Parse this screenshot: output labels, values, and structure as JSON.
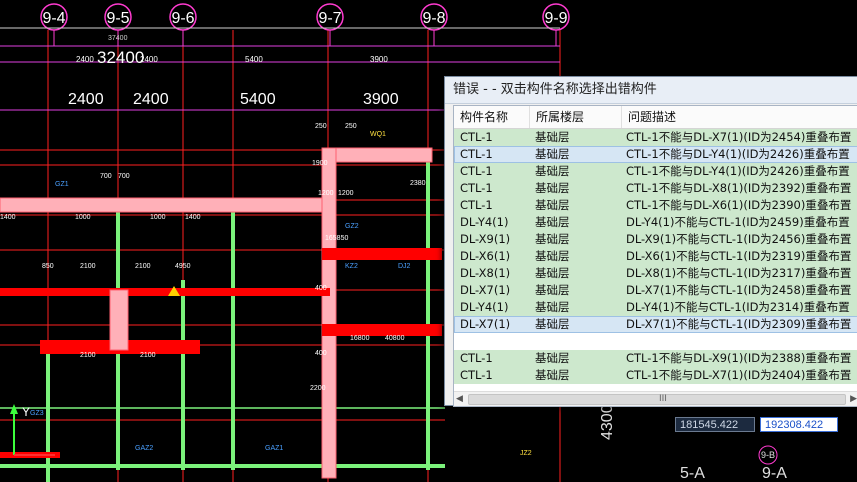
{
  "cad": {
    "axis_labels": [
      "9-4",
      "9-5",
      "9-6",
      "9-7",
      "9-8",
      "9-9"
    ],
    "dim_total_small": "37400",
    "dim_total": "32400",
    "dim_small": [
      "2400",
      "2400",
      "5400",
      "3900"
    ],
    "dim_large": [
      "2400",
      "2400",
      "5400",
      "3900"
    ],
    "misc_labels": [
      "700",
      "700",
      "1000",
      "1000",
      "1400",
      "1400",
      "2100",
      "2100",
      "2100",
      "2100",
      "1200",
      "1200",
      "250",
      "250",
      "WQ1",
      "GZ1",
      "GZ2",
      "GZ3",
      "GAZ1",
      "GAZ2",
      "JZ2",
      "KZ2",
      "DJ2",
      "16800",
      "40800",
      "165850",
      "850",
      "4950",
      "400",
      "400",
      "2200",
      "1900",
      "2380"
    ],
    "bottom_labels": [
      "5-A",
      "9-A",
      "9-B"
    ],
    "side_label": "4300",
    "ucs_y": "Y"
  },
  "dialog": {
    "title": "错误 - - 双击构件名称选择出错构件",
    "columns": [
      "构件名称",
      "所属楼层",
      "问题描述"
    ],
    "rows": [
      {
        "name": "CTL-1",
        "floor": "基础层",
        "desc": "CTL-1不能与DL-X7(1)(ID为2454)重叠布置"
      },
      {
        "name": "CTL-1",
        "floor": "基础层",
        "desc": "CTL-1不能与DL-Y4(1)(ID为2426)重叠布置"
      },
      {
        "name": "CTL-1",
        "floor": "基础层",
        "desc": "CTL-1不能与DL-Y4(1)(ID为2426)重叠布置"
      },
      {
        "name": "CTL-1",
        "floor": "基础层",
        "desc": "CTL-1不能与DL-X8(1)(ID为2392)重叠布置"
      },
      {
        "name": "CTL-1",
        "floor": "基础层",
        "desc": "CTL-1不能与DL-X6(1)(ID为2390)重叠布置"
      },
      {
        "name": "DL-Y4(1)",
        "floor": "基础层",
        "desc": "DL-Y4(1)不能与CTL-1(ID为2459)重叠布置"
      },
      {
        "name": "DL-X9(1)",
        "floor": "基础层",
        "desc": "DL-X9(1)不能与CTL-1(ID为2456)重叠布置"
      },
      {
        "name": "DL-X6(1)",
        "floor": "基础层",
        "desc": "DL-X6(1)不能与CTL-1(ID为2319)重叠布置"
      },
      {
        "name": "DL-X8(1)",
        "floor": "基础层",
        "desc": "DL-X8(1)不能与CTL-1(ID为2317)重叠布置"
      },
      {
        "name": "DL-X7(1)",
        "floor": "基础层",
        "desc": "DL-X7(1)不能与CTL-1(ID为2458)重叠布置"
      },
      {
        "name": "DL-Y4(1)",
        "floor": "基础层",
        "desc": "DL-Y4(1)不能与CTL-1(ID为2314)重叠布置"
      },
      {
        "name": "DL-X7(1)",
        "floor": "基础层",
        "desc": "DL-X7(1)不能与CTL-1(ID为2309)重叠布置"
      }
    ],
    "rows_after_gap": [
      {
        "name": "CTL-1",
        "floor": "基础层",
        "desc": "CTL-1不能与DL-X9(1)(ID为2388)重叠布置"
      },
      {
        "name": "CTL-1",
        "floor": "基础层",
        "desc": "CTL-1不能与DL-X7(1)(ID为2404)重叠布置"
      }
    ],
    "selected_rows": [
      1,
      11
    ],
    "scroll_grip": "III"
  },
  "coords": {
    "x": "181545.422",
    "y": "192308.422"
  },
  "colors": {
    "grid_red": "#ff2020",
    "wall_green": "#7cf27c",
    "beam_red": "#ff0000",
    "highlight_pink": "#ffb0b8",
    "axis_magenta": "#ff3bd0",
    "selected_row": "#d6e6f4",
    "row_green": "#cde8cd"
  }
}
